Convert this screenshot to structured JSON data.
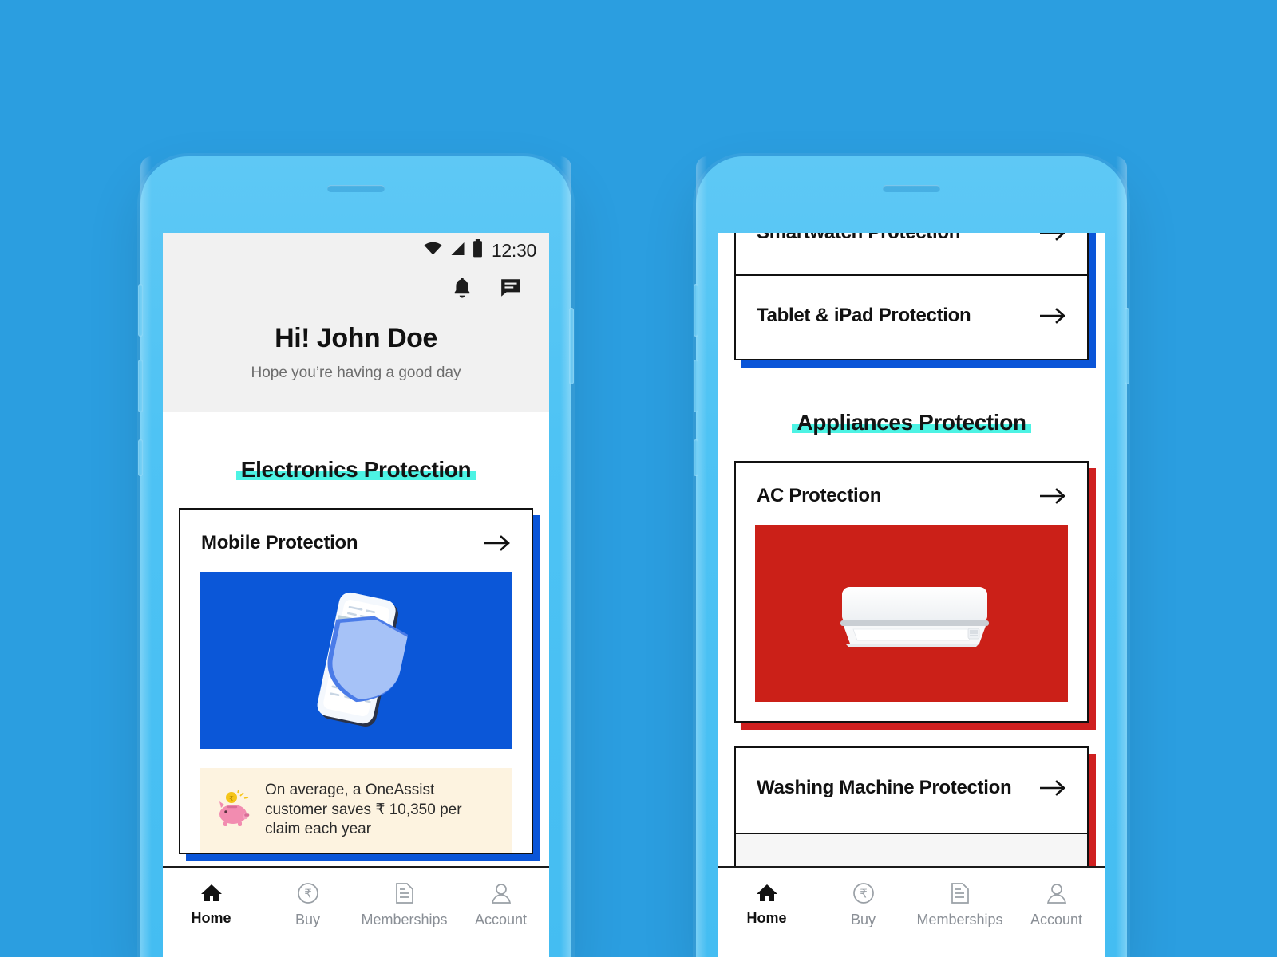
{
  "theme": {
    "background": "#2b9ee0",
    "phone_body": "#4ec3f4",
    "highlight_cyan": "#4df3e4",
    "card_shadow_blue": "#0a55d8",
    "card_shadow_red": "#cf2020",
    "media_blue": "#0b57d8",
    "media_red": "#cb2018",
    "promo_bg": "#fdf3e0"
  },
  "left_phone": {
    "status_bar": {
      "time": "12:30",
      "icons": [
        "wifi-icon",
        "cellular-signal-icon",
        "battery-icon"
      ]
    },
    "header": {
      "actions": [
        {
          "name": "notifications-bell-icon",
          "label": "Notifications"
        },
        {
          "name": "chat-message-icon",
          "label": "Chat"
        }
      ],
      "greeting": "Hi! John Doe",
      "subtitle": "Hope you’re having a good day"
    },
    "section": {
      "title": "Electronics Protection"
    },
    "cards": [
      {
        "title": "Mobile Protection",
        "arrow": "arrow-right-icon",
        "media": "phone-with-shield-illustration",
        "media_color": "#0b57d8"
      }
    ],
    "promo": {
      "icon": "piggy-bank-icon",
      "text": "On average, a OneAssist customer saves ₹ 10,350 per claim each year"
    },
    "bottom_nav": {
      "items": [
        {
          "label": "Home",
          "icon": "home-icon",
          "active": true
        },
        {
          "label": "Buy",
          "icon": "rupee-circle-icon",
          "active": false
        },
        {
          "label": "Memberships",
          "icon": "document-icon",
          "active": false
        },
        {
          "label": "Account",
          "icon": "person-icon",
          "active": false
        }
      ]
    }
  },
  "right_phone": {
    "top_cards": [
      {
        "title": "Smartwatch Protection",
        "arrow": "arrow-right-icon"
      },
      {
        "title": "Tablet & iPad Protection",
        "arrow": "arrow-right-icon"
      }
    ],
    "section": {
      "title": "Appliances Protection"
    },
    "cards": [
      {
        "title": "AC Protection",
        "arrow": "arrow-right-icon",
        "media": "air-conditioner-photo",
        "media_color": "#cb2018"
      },
      {
        "title": "Washing Machine Protection",
        "arrow": "arrow-right-icon"
      }
    ],
    "bottom_nav": {
      "items": [
        {
          "label": "Home",
          "icon": "home-icon",
          "active": true
        },
        {
          "label": "Buy",
          "icon": "rupee-circle-icon",
          "active": false
        },
        {
          "label": "Memberships",
          "icon": "document-icon",
          "active": false
        },
        {
          "label": "Account",
          "icon": "person-icon",
          "active": false
        }
      ]
    }
  }
}
